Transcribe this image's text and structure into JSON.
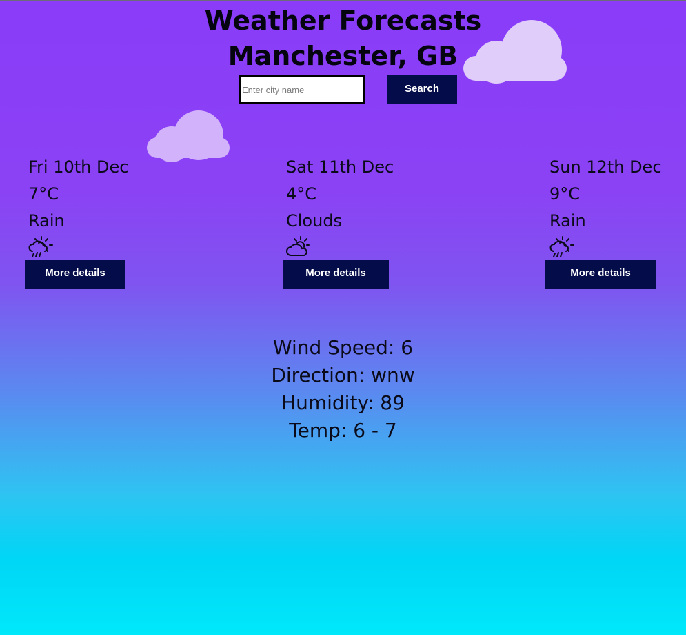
{
  "header": {
    "title": "Weather Forecasts",
    "location": "Manchester, GB"
  },
  "search": {
    "placeholder": "Enter city name",
    "value": "",
    "button_label": "Search"
  },
  "forecast": [
    {
      "date": "Fri 10th Dec",
      "temp": "7°C",
      "condition": "Rain",
      "icon": "rain-sun-icon",
      "button_label": "More details"
    },
    {
      "date": "Sat 11th Dec",
      "temp": "4°C",
      "condition": "Clouds",
      "icon": "cloud-sun-icon",
      "button_label": "More details"
    },
    {
      "date": "Sun 12th Dec",
      "temp": "9°C",
      "condition": "Rain",
      "icon": "rain-sun-icon",
      "button_label": "More details"
    }
  ],
  "details": {
    "wind_speed": "Wind Speed: 6",
    "direction": "Direction: wnw",
    "humidity": "Humidity: 89",
    "temp": "Temp: 6 - 7"
  },
  "colors": {
    "gradient_top": "#8a3cf8",
    "gradient_bottom": "#00e8fa",
    "button_bg": "#050c4a",
    "cloud_big": "#e0cdfa",
    "cloud_small": "#d2b2fb"
  }
}
